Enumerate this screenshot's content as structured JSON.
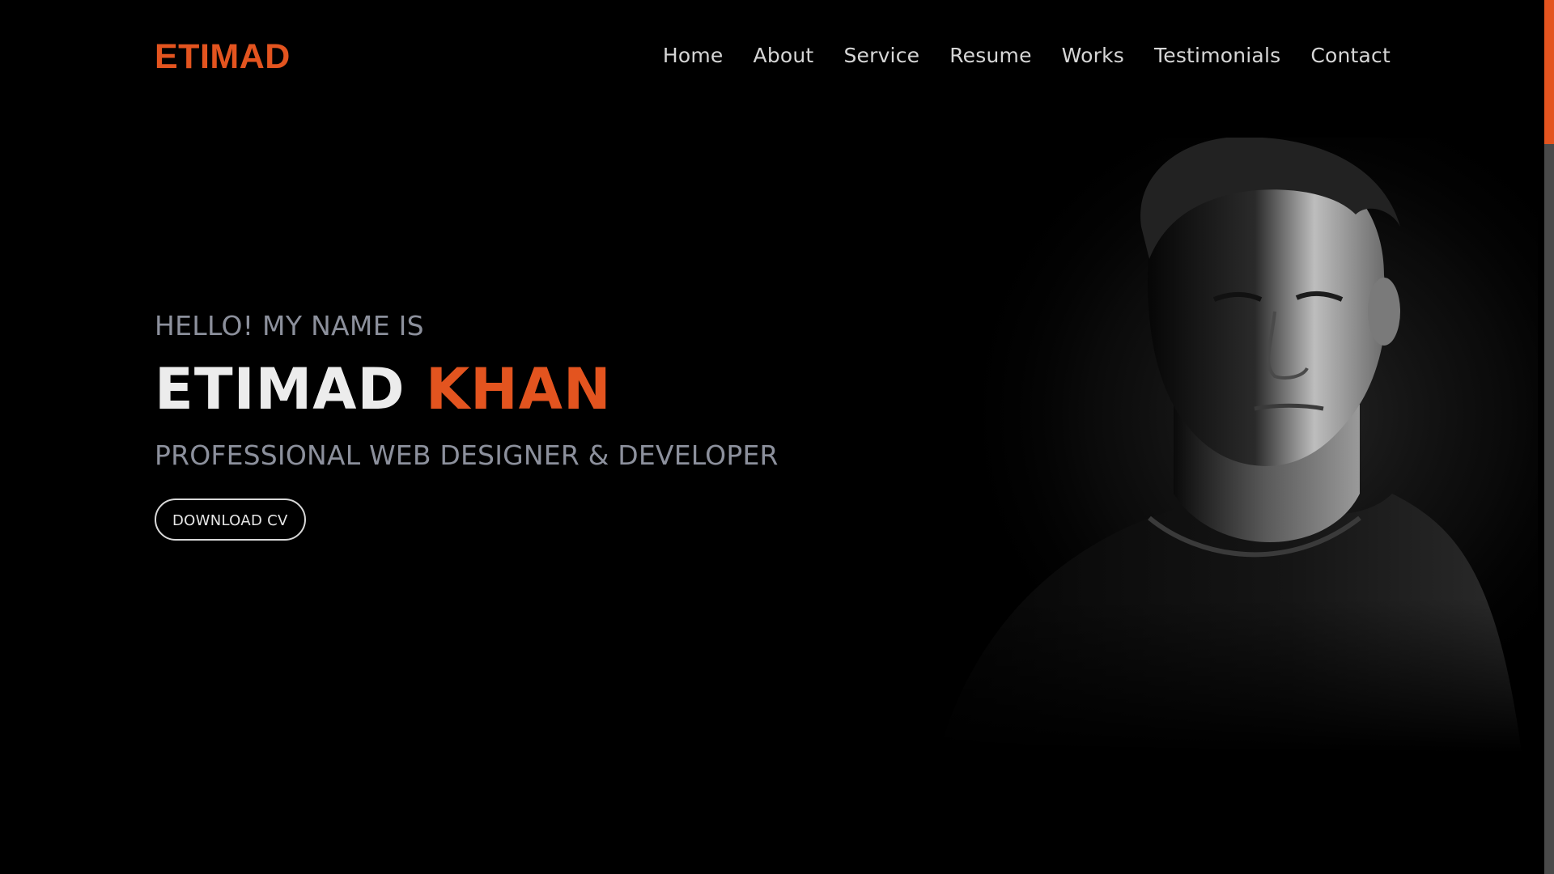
{
  "brand": {
    "name": "ETIMAD",
    "color": "#e3541f"
  },
  "nav": {
    "items": [
      {
        "label": "Home"
      },
      {
        "label": "About"
      },
      {
        "label": "Service"
      },
      {
        "label": "Resume"
      },
      {
        "label": "Works"
      },
      {
        "label": "Testimonials"
      },
      {
        "label": "Contact"
      }
    ]
  },
  "hero": {
    "greeting": "HELLO! MY NAME IS",
    "first_name": "ETIMAD",
    "last_name": "KHAN",
    "role": "PROFESSIONAL WEB DESIGNER & DEVELOPER",
    "cv_button": "DOWNLOAD CV",
    "portrait_icon": "person-portrait-photo"
  },
  "colors": {
    "accent": "#e3541f",
    "background": "#000000",
    "muted_text": "#8c909c"
  },
  "scrollbar": {
    "position_fraction": 0.0
  }
}
